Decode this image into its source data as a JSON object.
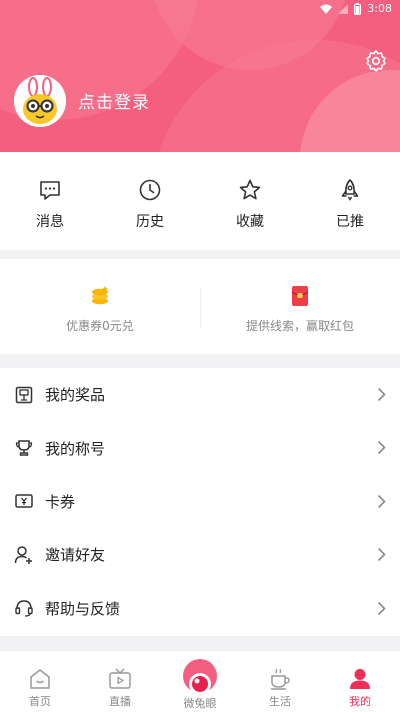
{
  "status_bar": {
    "time": "3:08"
  },
  "header": {
    "login_text": "点击登录"
  },
  "quick_actions": [
    {
      "label": "消息",
      "icon": "message-icon"
    },
    {
      "label": "历史",
      "icon": "clock-icon"
    },
    {
      "label": "收藏",
      "icon": "star-icon"
    },
    {
      "label": "已推",
      "icon": "rocket-icon"
    }
  ],
  "coupons": [
    {
      "label": "优惠券0元兑",
      "icon": "coins-icon"
    },
    {
      "label": "提供线索，赢取红包",
      "icon": "red-envelope-icon"
    }
  ],
  "menu": [
    {
      "label": "我的奖品",
      "icon": "prize-icon"
    },
    {
      "label": "我的称号",
      "icon": "trophy-icon"
    },
    {
      "label": "卡券",
      "icon": "coupon-card-icon"
    },
    {
      "label": "邀请好友",
      "icon": "add-user-icon"
    },
    {
      "label": "帮助与反馈",
      "icon": "headset-icon"
    }
  ],
  "tabs": [
    {
      "label": "首页",
      "icon": "home-icon"
    },
    {
      "label": "直播",
      "icon": "tv-icon"
    },
    {
      "label": "微兔眼",
      "icon": "eye-icon"
    },
    {
      "label": "生活",
      "icon": "cup-icon"
    },
    {
      "label": "我的",
      "icon": "person-icon"
    }
  ],
  "colors": {
    "brand": "#f45f7f",
    "active_tab": "#ee2f57",
    "gold": "#f7b500",
    "red": "#ef3d4a"
  }
}
